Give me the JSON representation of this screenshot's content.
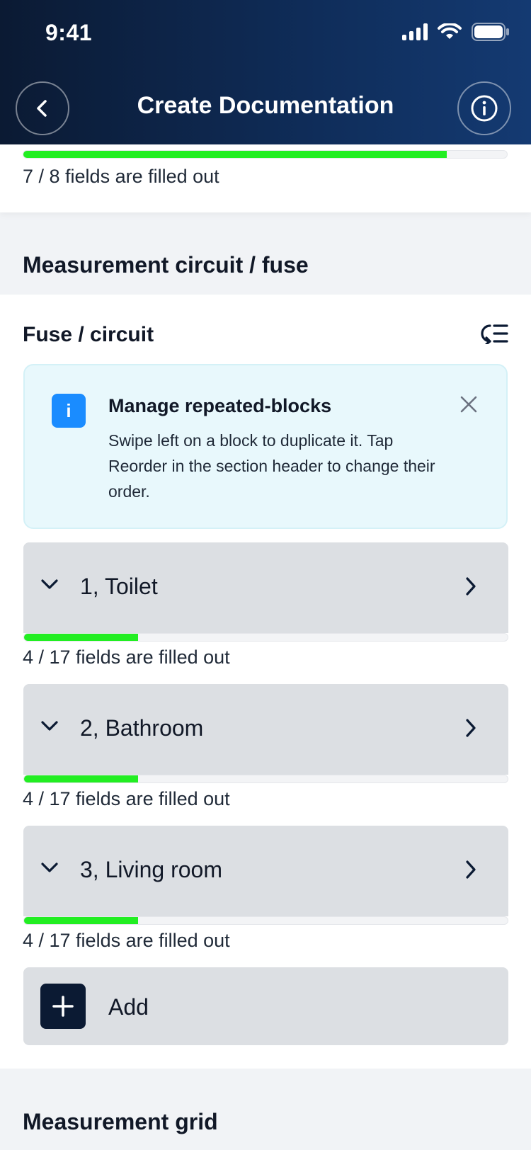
{
  "status_bar": {
    "time": "9:41"
  },
  "header": {
    "title": "Create Documentation"
  },
  "top_progress": {
    "text": "7 / 8 fields are filled out",
    "filled": 7,
    "total": 8
  },
  "section": {
    "title": "Measurement circuit / fuse",
    "subtitle": "Fuse / circuit",
    "info_box": {
      "title": "Manage repeated-blocks",
      "body": "Swipe left on a block to duplicate it. Tap Reorder in the section header to change their order."
    },
    "blocks": [
      {
        "label": "1, Toilet",
        "progress_text": "4 / 17 fields are filled out",
        "filled": 4,
        "total": 17
      },
      {
        "label": "2, Bathroom",
        "progress_text": "4 / 17 fields are filled out",
        "filled": 4,
        "total": 17
      },
      {
        "label": "3, Living room",
        "progress_text": "4 / 17 fields are filled out",
        "filled": 4,
        "total": 17
      }
    ],
    "add_label": "Add"
  },
  "next_section": {
    "title": "Measurement grid"
  },
  "colors": {
    "header_bg": "#0f2d5a",
    "progress_fill": "#22ee22",
    "info_bg": "#e8f8fc",
    "info_badge": "#1a8cff",
    "block_bg": "#dcdfe3"
  }
}
